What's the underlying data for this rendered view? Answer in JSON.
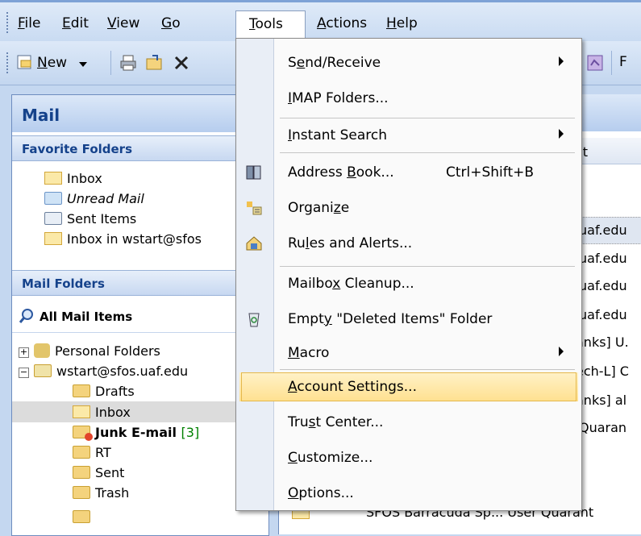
{
  "menubar": {
    "items": [
      {
        "label": "File",
        "u": "F",
        "rest": "ile"
      },
      {
        "label": "Edit",
        "u": "E",
        "rest": "dit"
      },
      {
        "label": "View",
        "u": "V",
        "rest": "iew"
      },
      {
        "label": "Go",
        "u": "G",
        "rest": "o"
      },
      {
        "label": "Tools",
        "u": "T",
        "rest": "ools"
      },
      {
        "label": "Actions",
        "u": "A",
        "rest": "ctions"
      },
      {
        "label": "Help",
        "u": "H",
        "rest": "elp"
      }
    ]
  },
  "toolbar": {
    "new_u": "N",
    "new_rest": "ew",
    "right_label": "F"
  },
  "nav": {
    "title": "Mail",
    "favorites_header": "Favorite Folders",
    "favorites": [
      "Inbox",
      "Unread Mail",
      "Sent Items",
      "Inbox in wstart@sfos"
    ],
    "mail_folders_header": "Mail Folders",
    "all_mail_items": "All Mail Items",
    "personal_folders": "Personal Folders",
    "account": "wstart@sfos.uaf.edu",
    "folders": [
      {
        "name": "Drafts"
      },
      {
        "name": "Inbox"
      },
      {
        "name": "Junk E-mail",
        "count": "[3]"
      },
      {
        "name": "RT"
      },
      {
        "name": "Sent"
      },
      {
        "name": "Trash"
      }
    ]
  },
  "list": {
    "header": "ct",
    "rows": [
      "uaf.edu",
      "uaf.edu",
      "uaf.edu",
      "uaf.edu",
      "anks] U.",
      "ech-L] C",
      "anks] al",
      "Quaran"
    ],
    "bottom_row": "SFOS Barracuda Sp...  User Quarant"
  },
  "tools_menu": {
    "items": [
      {
        "pre": "S",
        "u": "e",
        "post": "nd/Receive",
        "submenu": true
      },
      {
        "pre": "",
        "u": "I",
        "post": "MAP Folders...",
        "submenu": false
      },
      {
        "pre": "",
        "u": "I",
        "post": "nstant Search",
        "submenu": true
      },
      {
        "pre": "Address ",
        "u": "B",
        "post": "ook...",
        "shortcut": "Ctrl+Shift+B",
        "icon": "address-book-icon"
      },
      {
        "pre": "Organi",
        "u": "z",
        "post": "e",
        "icon": "organize-icon"
      },
      {
        "pre": "Ru",
        "u": "l",
        "post": "es and Alerts...",
        "icon": "rules-alerts-icon"
      },
      {
        "pre": "Mailbo",
        "u": "x",
        "post": " Cleanup..."
      },
      {
        "pre": "Empt",
        "u": "y",
        "post": " \"Deleted Items\" Folder",
        "icon": "recycle-bin-icon"
      },
      {
        "pre": "",
        "u": "M",
        "post": "acro",
        "submenu": true
      },
      {
        "pre": "",
        "u": "A",
        "post": "ccount Settings...",
        "highlighted": true
      },
      {
        "pre": "Tru",
        "u": "s",
        "post": "t Center..."
      },
      {
        "pre": "",
        "u": "C",
        "post": "ustomize..."
      },
      {
        "pre": "",
        "u": "O",
        "post": "ptions..."
      }
    ]
  },
  "colors": {
    "highlight": "#ffe08f",
    "nav_title": "#15428b",
    "junk_count": "#008000"
  }
}
